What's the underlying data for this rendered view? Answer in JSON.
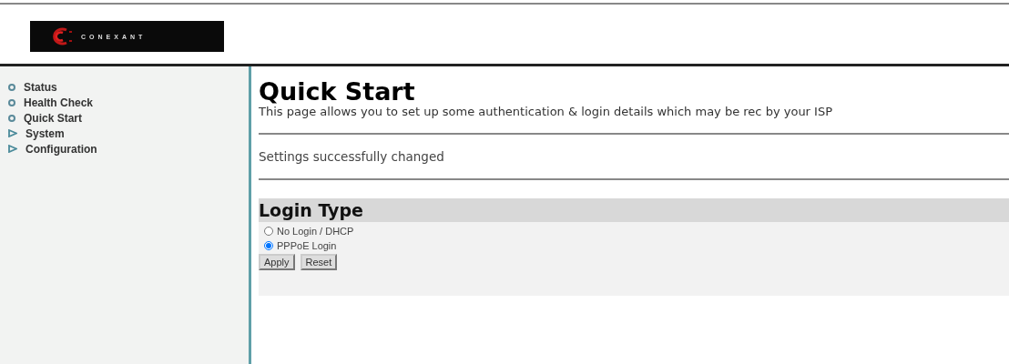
{
  "logo": {
    "text": "CONEXANT"
  },
  "sidebar": {
    "items": [
      {
        "label": "Status",
        "kind": "bullet"
      },
      {
        "label": "Health Check",
        "kind": "bullet"
      },
      {
        "label": "Quick Start",
        "kind": "bullet"
      },
      {
        "label": "System",
        "kind": "arrow"
      },
      {
        "label": "Configuration",
        "kind": "arrow"
      }
    ]
  },
  "page": {
    "title": "Quick Start",
    "description": "This page allows you to set up some authentication & login details which may be rec by your ISP",
    "message": "Settings successfully changed"
  },
  "login_type": {
    "heading": "Login Type",
    "options": [
      {
        "label": "No Login / DHCP",
        "selected": false
      },
      {
        "label": "PPPoE Login",
        "selected": true
      }
    ],
    "buttons": [
      "Apply",
      "Reset"
    ]
  }
}
